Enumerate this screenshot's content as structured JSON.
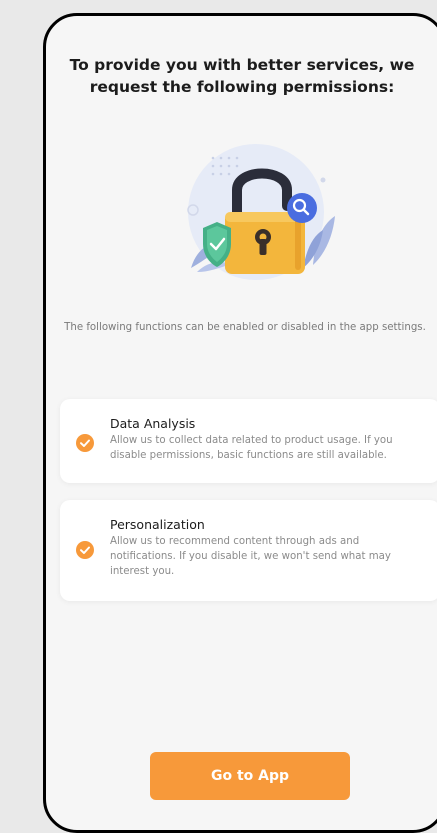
{
  "consent": {
    "title": "To provide you with better services, we request the following permissions:",
    "subtitle": "The following functions can be enabled or disabled in the app settings.",
    "illustration": "padlock-with-shield-and-search-icon",
    "permissions": [
      {
        "label": "Data Analysis",
        "description": "Allow us to collect data related to product usage. If you disable permissions, basic functions are still available.",
        "checked": true
      },
      {
        "label": "Personalization",
        "description": "Allow us to recommend content through ads and notifications. If you disable it, we won't send what may interest you.",
        "checked": true
      }
    ],
    "cta_label": "Go to App"
  },
  "colors": {
    "accent": "#f7993a",
    "background": "#f6f6f6",
    "card": "#ffffff"
  }
}
